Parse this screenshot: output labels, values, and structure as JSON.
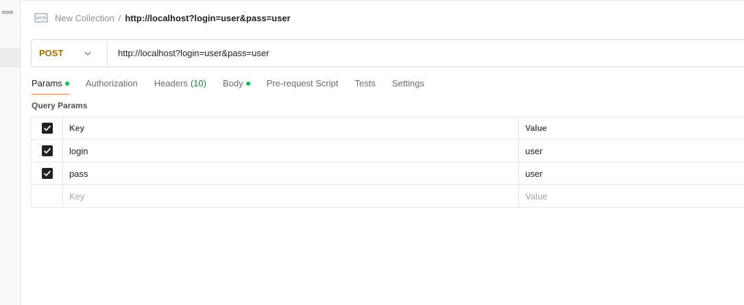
{
  "breadcrumb": {
    "icon": "http-request-icon",
    "parent": "New Collection",
    "separator": "/",
    "current": "http://localhost?login=user&pass=user"
  },
  "request": {
    "method": "POST",
    "url": "http://localhost?login=user&pass=user"
  },
  "tabs": [
    {
      "label": "Params",
      "active": true,
      "dot": true
    },
    {
      "label": "Authorization"
    },
    {
      "label": "Headers",
      "count": "(10)"
    },
    {
      "label": "Body",
      "dot": true
    },
    {
      "label": "Pre-request Script"
    },
    {
      "label": "Tests"
    },
    {
      "label": "Settings"
    }
  ],
  "query_params": {
    "title": "Query Params",
    "header": {
      "key": "Key",
      "value": "Value"
    },
    "rows": [
      {
        "key": "login",
        "value": "user",
        "checked": true
      },
      {
        "key": "pass",
        "value": "user",
        "checked": true
      }
    ],
    "new_row": {
      "key_placeholder": "Key",
      "value_placeholder": "Value"
    }
  },
  "colors": {
    "method": "#a36d00",
    "active_tab_underline": "#ff6c37",
    "status_dot": "#0cbb52",
    "count": "#0e8a3f"
  }
}
